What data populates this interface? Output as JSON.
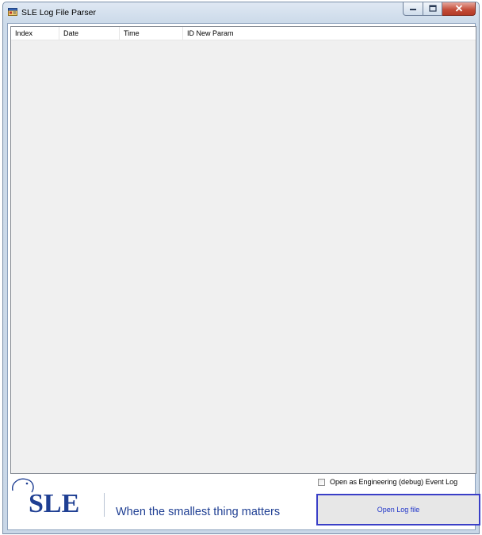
{
  "window": {
    "title": "SLE Log File Parser"
  },
  "listview": {
    "columns": [
      "Index",
      "Date",
      "Time",
      "ID New Param"
    ],
    "rows": []
  },
  "footer": {
    "logo_text": "SLE",
    "tagline": "When the smallest thing matters",
    "debug_checkbox_label": "Open as Engineering (debug) Event Log",
    "debug_checkbox_checked": false,
    "open_button_label": "Open Log file"
  },
  "icons": {
    "app": "app-window-icon",
    "minimize": "minimize-icon",
    "maximize": "maximize-icon",
    "close": "close-icon"
  },
  "colors": {
    "accent_blue": "#1f3f93",
    "button_border": "#3a3fc7",
    "close_red": "#c24a36"
  }
}
